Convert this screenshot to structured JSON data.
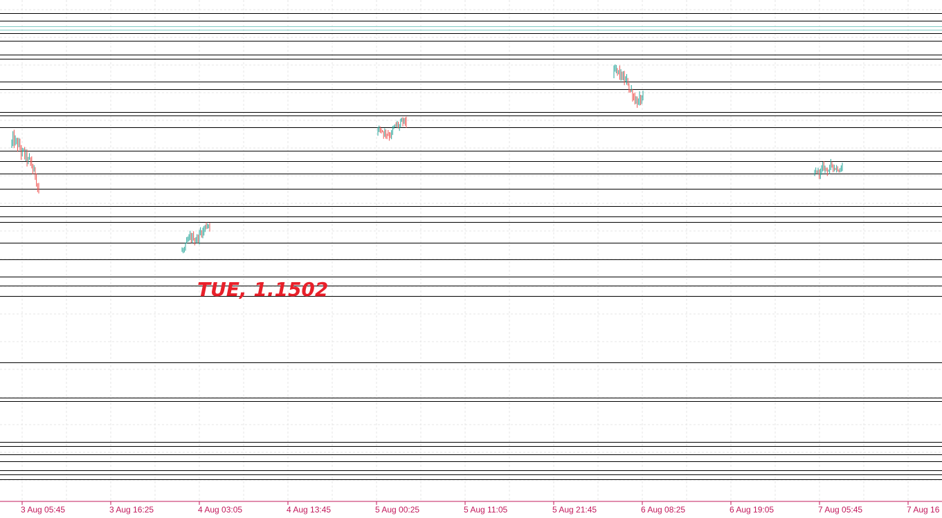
{
  "chart_data": {
    "type": "candlestick",
    "annotation": "TUE, 1.1502",
    "x_tick_labels": [
      "3 Aug 05:45",
      "3 Aug 16:25",
      "4 Aug 03:05",
      "4 Aug 13:45",
      "5 Aug 00:25",
      "5 Aug 11:05",
      "5 Aug 21:45",
      "6 Aug 08:25",
      "6 Aug 19:05",
      "7 Aug 05:45",
      "7 Aug 16"
    ],
    "grid": true,
    "sessions": [
      {
        "start": "3 Aug 04:30",
        "end": "3 Aug 07:45",
        "open": 1.1574,
        "high": 1.1581,
        "low": 1.1542,
        "close": 1.1551
      },
      {
        "start": "4 Aug 01:00",
        "end": "4 Aug 04:20",
        "open": 1.152,
        "high": 1.1537,
        "low": 1.1509,
        "close": 1.1538
      },
      {
        "start": "5 Aug 00:35",
        "end": "5 Aug 04:00",
        "open": 1.158,
        "high": 1.16,
        "low": 1.1572,
        "close": 1.1583
      },
      {
        "start": "6 Aug 05:00",
        "end": "6 Aug 08:30",
        "open": 1.1608,
        "high": 1.1618,
        "low": 1.1585,
        "close": 1.1592
      },
      {
        "start": "7 Aug 05:10",
        "end": "7 Aug 08:30",
        "open": 1.1559,
        "high": 1.1569,
        "low": 1.1544,
        "close": 1.1565
      }
    ],
    "colors": {
      "bull": "#26a69a",
      "bear": "#ef5350",
      "level_line": "#000000",
      "axis": "#c2185b",
      "annotation": "#e8202a",
      "grid": "#e6e6e6",
      "teal_line": "#80cbc4"
    }
  }
}
